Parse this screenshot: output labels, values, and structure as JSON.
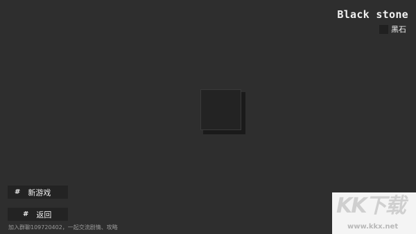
{
  "header": {
    "title": "Black stone",
    "subtitle": "黑石"
  },
  "menu": {
    "new_game": {
      "marker": "#",
      "label": "新游戏"
    },
    "back": {
      "marker": "#",
      "label": "返回"
    }
  },
  "footer": {
    "text": "加入群聊109720402，一起交流剧情、攻略"
  },
  "watermark": {
    "logo": "KK下载",
    "url": "www.kkx.net"
  },
  "colors": {
    "background": "#2e2e2e",
    "stone": "#232323",
    "stone_shadow": "#1a1a1a",
    "button_bg": "#232323"
  },
  "icons": {
    "stone": "black-stone-block",
    "swatch": "black-square"
  }
}
